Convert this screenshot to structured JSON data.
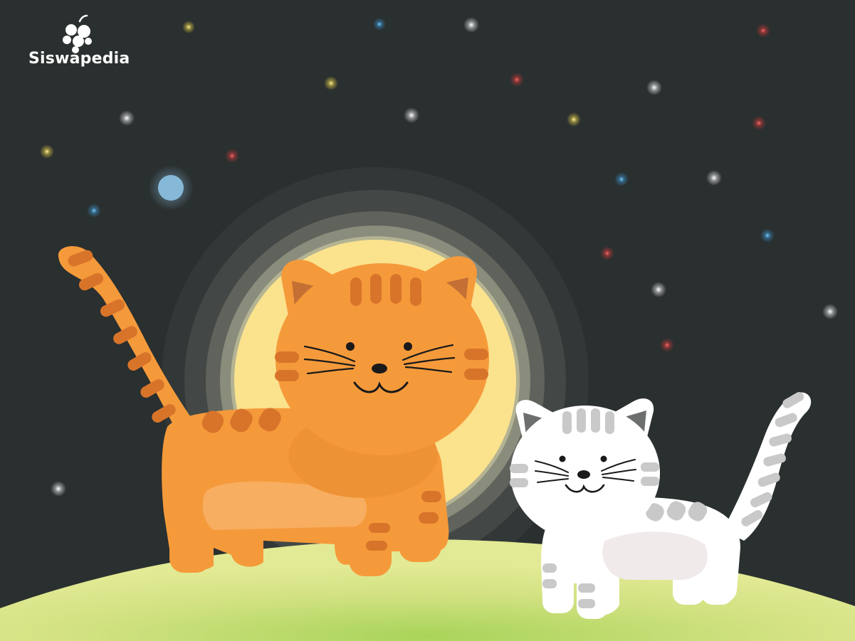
{
  "brand": {
    "name": "Siswapedia",
    "logo_icon": "grape-cluster-logo-icon",
    "color": "#ffffff"
  },
  "scene": {
    "background_color": "#2a2f2f",
    "moon_color": "#fbe28d",
    "hill_color": "#cfe07a",
    "orange_cat_color": "#f59a3b",
    "white_cat_color": "#ffffff"
  }
}
